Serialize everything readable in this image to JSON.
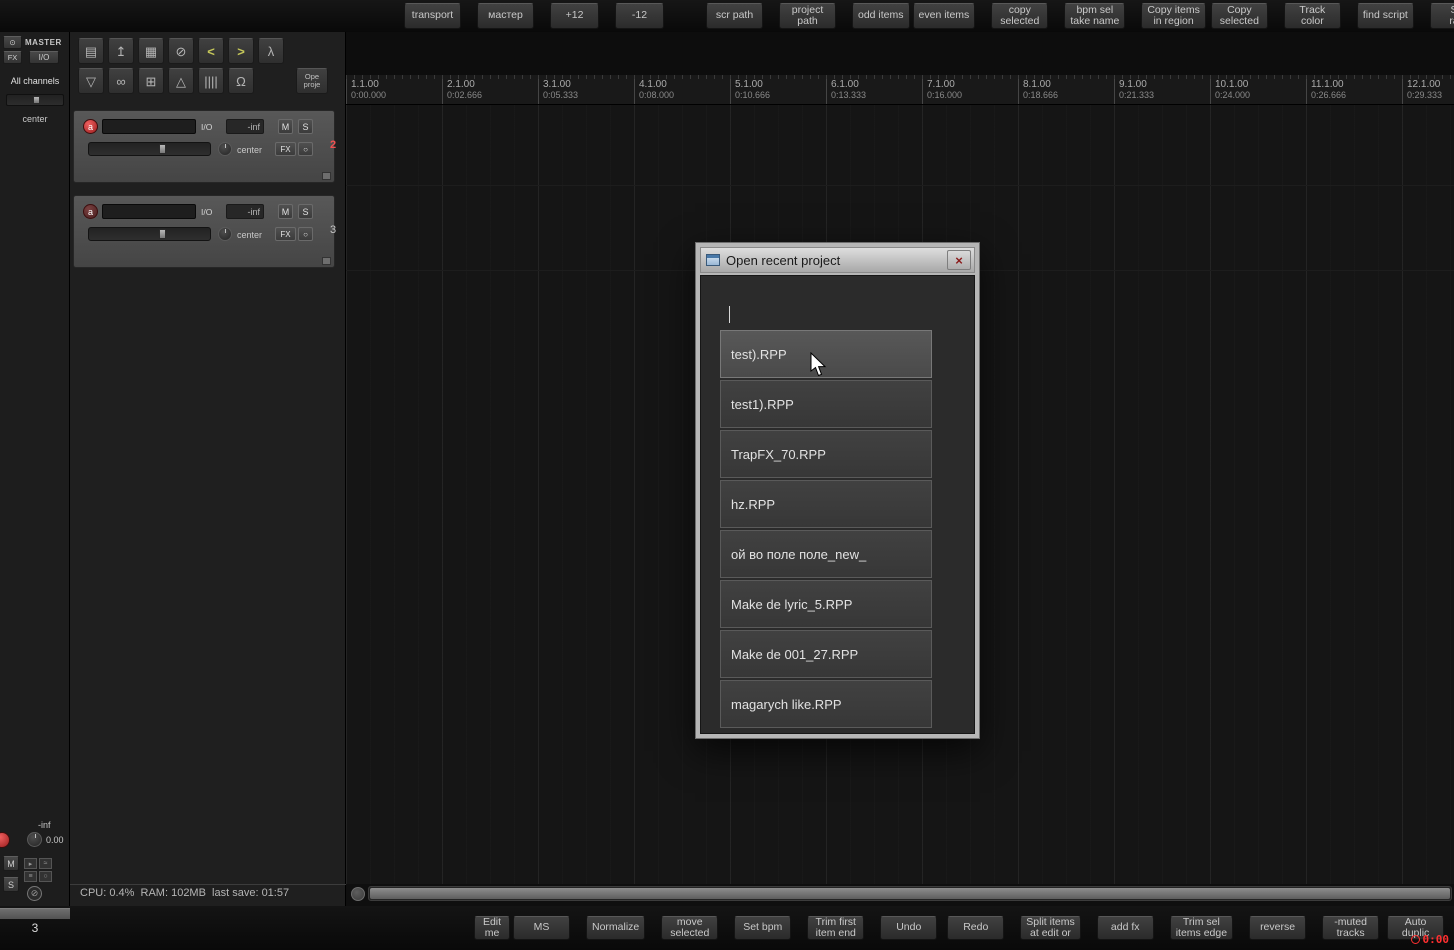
{
  "top_toolbar": {
    "buttons": [
      {
        "name": "transport-button",
        "label": "transport"
      },
      {
        "name": "master-button",
        "label": "мастер"
      },
      {
        "name": "plus12-button",
        "label": "+12"
      },
      {
        "name": "minus12-button",
        "label": "-12"
      },
      {
        "name": "scr-path-button",
        "label": "scr path"
      },
      {
        "name": "project-path-button",
        "label": "project\npath"
      },
      {
        "name": "odd-items-button",
        "label": "odd items"
      },
      {
        "name": "even-items-button",
        "label": "even items"
      },
      {
        "name": "copy-selected-button",
        "label": "copy\nselected"
      },
      {
        "name": "bpm-sel-take-name-button",
        "label": "bpm sel\ntake name"
      },
      {
        "name": "copy-items-in-region-button",
        "label": "Copy items\nin region"
      },
      {
        "name": "copy-selected-2-button",
        "label": "Copy\nselected"
      },
      {
        "name": "track-color-button",
        "label": "Track\ncolor"
      },
      {
        "name": "find-script-button",
        "label": "find script"
      },
      {
        "name": "set-rate-button",
        "label": "Set\nrate"
      }
    ]
  },
  "bottom_toolbar": {
    "buttons": [
      {
        "name": "edit-me-button",
        "label": "Edit\nme"
      },
      {
        "name": "ms-button",
        "label": "MS"
      },
      {
        "name": "normalize-button",
        "label": "Normalize"
      },
      {
        "name": "move-selected-button",
        "label": "move\nselected"
      },
      {
        "name": "set-bpm-button",
        "label": "Set bpm"
      },
      {
        "name": "trim-first-item-end-button",
        "label": "Trim first\nitem end"
      },
      {
        "name": "undo-button",
        "label": "Undo"
      },
      {
        "name": "redo-button",
        "label": "Redo"
      },
      {
        "name": "split-items-at-edit-button",
        "label": "Split items\nat edit or"
      },
      {
        "name": "add-fx-button",
        "label": "add fx"
      },
      {
        "name": "trim-sel-items-edge-button",
        "label": "Trim sel\nitems edge"
      },
      {
        "name": "reverse-button",
        "label": "reverse"
      },
      {
        "name": "muted-tracks-button",
        "label": "-muted\ntracks"
      },
      {
        "name": "auto-duplicate-button",
        "label": "Auto\nduplic"
      }
    ]
  },
  "tcp_toolbar": {
    "row1": [
      {
        "name": "notes-icon",
        "glyph": "▤"
      },
      {
        "name": "open-import-icon",
        "glyph": "↥"
      },
      {
        "name": "save-icon",
        "glyph": "▦"
      },
      {
        "name": "attach-icon",
        "glyph": "⊘"
      },
      {
        "name": "prev-arrow-icon",
        "glyph": "<"
      },
      {
        "name": "next-arrow-icon",
        "glyph": ">"
      },
      {
        "name": "action-lambda-icon",
        "glyph": "λ"
      }
    ],
    "row2": [
      {
        "name": "filter-funnel-icon",
        "glyph": "▽"
      },
      {
        "name": "link-icon",
        "glyph": "∞"
      },
      {
        "name": "grid-icon",
        "glyph": "⊞"
      },
      {
        "name": "normalize-triangle-icon",
        "glyph": "△"
      },
      {
        "name": "lines-icon",
        "glyph": "||||"
      },
      {
        "name": "magnet-snap-icon",
        "glyph": "Ω"
      }
    ],
    "open_project_label": "Ope\nproje"
  },
  "master": {
    "title": "MASTER",
    "power_glyph": "⊙",
    "fx": "FX",
    "io": "I/O",
    "all_channels": "All channels",
    "pan": "center",
    "volume": "-inf",
    "gain": "0.00",
    "mute": "M",
    "solo": "S",
    "phase_glyph": "⊘",
    "bottom_track_number": "3",
    "small_icons": [
      {
        "name": "routing-icon",
        "glyph": "▸"
      },
      {
        "name": "envelope-icon",
        "glyph": "≈"
      },
      {
        "name": "meter-icon",
        "glyph": "≡"
      },
      {
        "name": "monitor-icon",
        "glyph": "○"
      }
    ]
  },
  "tracks": [
    {
      "number": "2",
      "rec_label": "a",
      "io_label": "I/O",
      "volume": "-inf",
      "mute": "M",
      "solo": "S",
      "pan": "center",
      "fx": "FX",
      "bypass": "○"
    },
    {
      "number": "3",
      "rec_label": "a",
      "io_label": "I/O",
      "volume": "-inf",
      "mute": "M",
      "solo": "S",
      "pan": "center",
      "fx": "FX",
      "bypass": "○"
    }
  ],
  "ruler": {
    "measures": [
      {
        "bar": "1.1.00",
        "time": "0:00.000"
      },
      {
        "bar": "2.1.00",
        "time": "0:02.666"
      },
      {
        "bar": "3.1.00",
        "time": "0:05.333"
      },
      {
        "bar": "4.1.00",
        "time": "0:08.000"
      },
      {
        "bar": "5.1.00",
        "time": "0:10.666"
      },
      {
        "bar": "6.1.00",
        "time": "0:13.333"
      },
      {
        "bar": "7.1.00",
        "time": "0:16.000"
      },
      {
        "bar": "8.1.00",
        "time": "0:18.666"
      },
      {
        "bar": "9.1.00",
        "time": "0:21.333"
      },
      {
        "bar": "10.1.00",
        "time": "0:24.000"
      },
      {
        "bar": "11.1.00",
        "time": "0:26.666"
      },
      {
        "bar": "12.1.00",
        "time": "0:29.333"
      }
    ]
  },
  "status": {
    "text": "CPU: 0.4%  RAM: 102MB  last save: 01:57"
  },
  "clock": {
    "time": "0:00"
  },
  "dialog": {
    "title": "Open recent project",
    "close_glyph": "×",
    "filter_value": "",
    "items": [
      "test).RPP",
      "test1).RPP",
      "TrapFX_70.RPP",
      "hz.RPP",
      "ой во поле поле_new_",
      "Make de lyric_5.RPP",
      "Make de 001_27.RPP",
      "magarych like.RPP"
    ],
    "selected_item": "test).RPP"
  }
}
